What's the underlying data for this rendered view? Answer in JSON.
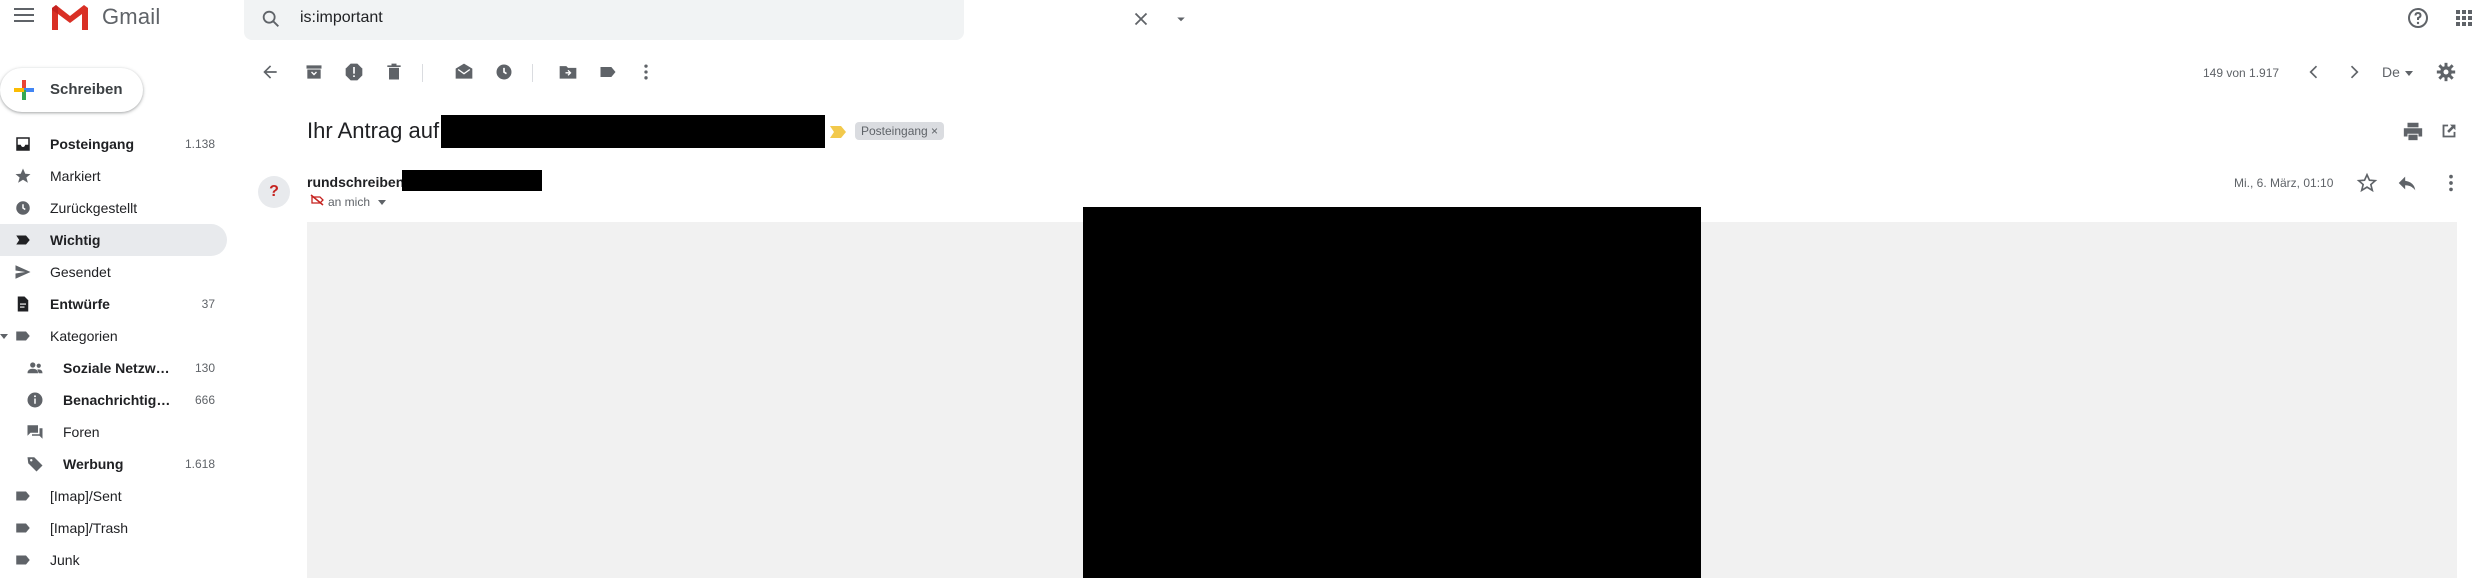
{
  "app": {
    "name": "Gmail"
  },
  "search": {
    "query": "is:important"
  },
  "compose": {
    "label": "Schreiben"
  },
  "sidebar": {
    "items": [
      {
        "label": "Posteingang",
        "count": "1.138",
        "bold": true
      },
      {
        "label": "Markiert",
        "count": ""
      },
      {
        "label": "Zurückgestellt",
        "count": ""
      },
      {
        "label": "Wichtig",
        "count": "",
        "active": true
      },
      {
        "label": "Gesendet",
        "count": ""
      },
      {
        "label": "Entwürfe",
        "count": "37"
      },
      {
        "label": "Kategorien",
        "count": ""
      },
      {
        "label": "Soziale Netzwe…",
        "count": "130"
      },
      {
        "label": "Benachrichtigu…",
        "count": "666"
      },
      {
        "label": "Foren",
        "count": ""
      },
      {
        "label": "Werbung",
        "count": "1.618"
      },
      {
        "label": "[Imap]/Sent",
        "count": ""
      },
      {
        "label": "[Imap]/Trash",
        "count": ""
      },
      {
        "label": "Junk",
        "count": ""
      }
    ]
  },
  "toolbar": {
    "pager": "149 von 1.917",
    "language": "De"
  },
  "message": {
    "subject_prefix": "Ihr Antrag auf",
    "label_chip": "Posteingang ×",
    "avatar_letter": "?",
    "sender_prefix": "rundschreiben",
    "recipient": "an mich",
    "date": "Mi., 6. März, 01:10"
  },
  "colors": {
    "accent_red": "#d93025",
    "important_marker": "#f2c94c",
    "active_nav": "#e8eaed"
  }
}
